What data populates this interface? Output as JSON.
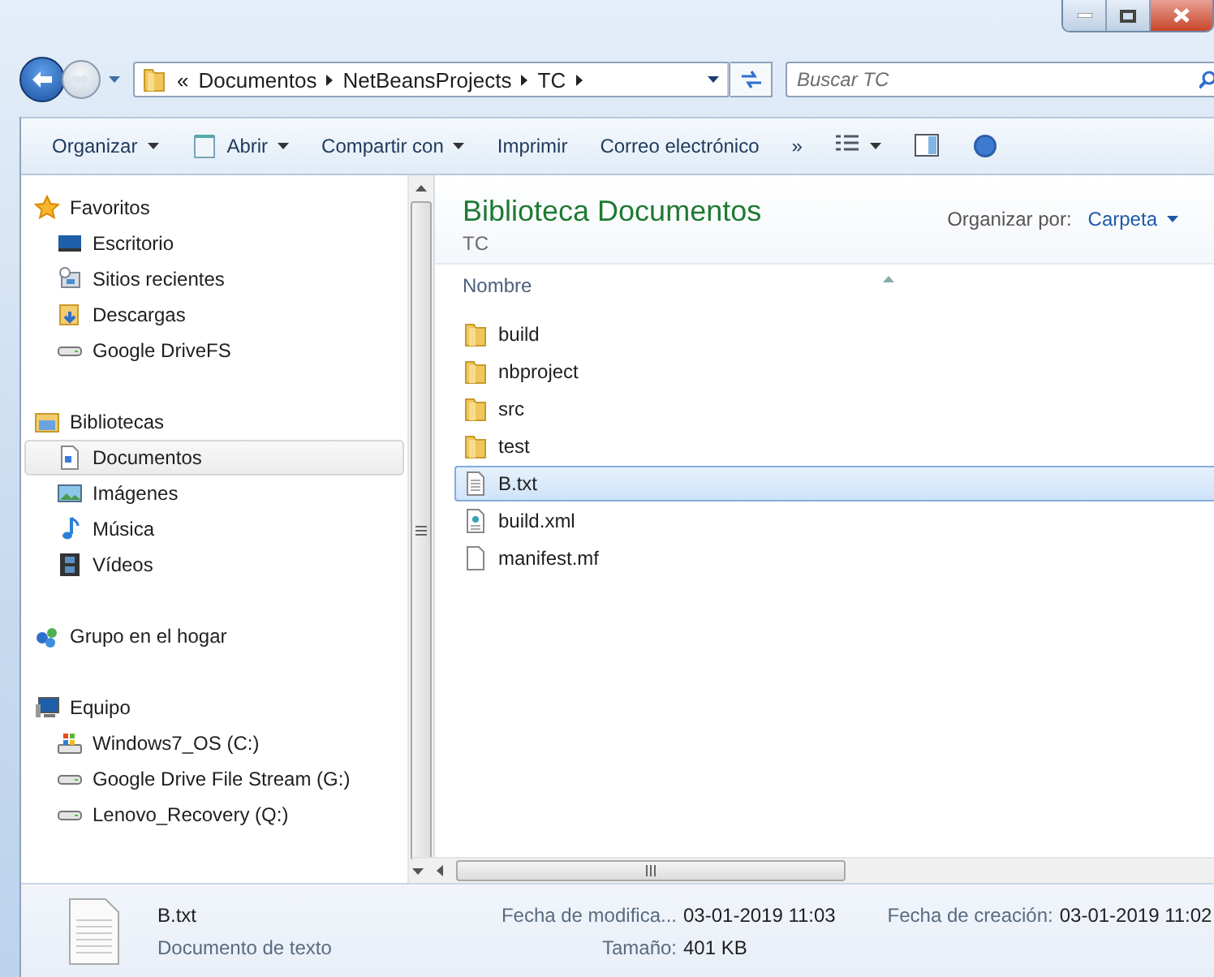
{
  "address_bar": {
    "overflow": "«",
    "crumbs": [
      "Documentos",
      "NetBeansProjects",
      "TC"
    ]
  },
  "search": {
    "placeholder": "Buscar TC"
  },
  "toolbar": [
    {
      "label": "Organizar",
      "dropdown": true,
      "kind": "text"
    },
    {
      "label": "Abrir",
      "dropdown": true,
      "kind": "notepad"
    },
    {
      "label": "Compartir con",
      "dropdown": true,
      "kind": "text"
    },
    {
      "label": "Imprimir",
      "dropdown": false,
      "kind": "text"
    },
    {
      "label": "Correo electrónico",
      "dropdown": false,
      "kind": "text"
    },
    {
      "label": "»",
      "dropdown": false,
      "kind": "text"
    },
    {
      "dropdown": true,
      "kind": "views"
    },
    {
      "dropdown": false,
      "kind": "preview"
    },
    {
      "dropdown": false,
      "kind": "help"
    }
  ],
  "sidebar": {
    "groups": [
      {
        "label": "Favoritos",
        "kind": "star",
        "children": [
          {
            "label": "Escritorio",
            "kind": "desktop",
            "selected": false
          },
          {
            "label": "Sitios recientes",
            "kind": "recent",
            "selected": false
          },
          {
            "label": "Descargas",
            "kind": "downloads",
            "selected": false
          },
          {
            "label": "Google DriveFS",
            "kind": "drive",
            "selected": false
          }
        ]
      },
      {
        "label": "Bibliotecas",
        "kind": "library",
        "children": [
          {
            "label": "Documentos",
            "kind": "document",
            "selected": true
          },
          {
            "label": "Imágenes",
            "kind": "image",
            "selected": false
          },
          {
            "label": "Música",
            "kind": "music",
            "selected": false
          },
          {
            "label": "Vídeos",
            "kind": "video",
            "selected": false
          }
        ]
      },
      {
        "label": "Grupo en el hogar",
        "kind": "homegroup"
      },
      {
        "label": "Equipo",
        "kind": "computer",
        "children": [
          {
            "label": "Windows7_OS (C:)",
            "kind": "windrive",
            "selected": false
          },
          {
            "label": "Google Drive File Stream (G:)",
            "kind": "drive",
            "selected": false
          },
          {
            "label": "Lenovo_Recovery (Q:)",
            "kind": "drive",
            "selected": false
          }
        ]
      }
    ]
  },
  "content": {
    "title": "Biblioteca Documentos",
    "subtitle": "TC",
    "arrange_label": "Organizar por:",
    "arrange_value": "Carpeta",
    "column": "Nombre",
    "files": [
      {
        "name": "build",
        "kind": "folder",
        "selected": false
      },
      {
        "name": "nbproject",
        "kind": "folder",
        "selected": false
      },
      {
        "name": "src",
        "kind": "folder",
        "selected": false
      },
      {
        "name": "test",
        "kind": "folder",
        "selected": false
      },
      {
        "name": "B.txt",
        "kind": "text",
        "selected": true
      },
      {
        "name": "build.xml",
        "kind": "xml",
        "selected": false
      },
      {
        "name": "manifest.mf",
        "kind": "file",
        "selected": false
      }
    ]
  },
  "details": {
    "name": "B.txt",
    "type": "Documento de texto",
    "properties": [
      {
        "label": "Fecha de modifica...",
        "value": "03-01-2019 11:03"
      },
      {
        "label": "Fecha de creación:",
        "value": "03-01-2019 11:02"
      },
      {
        "label": "Tamaño:",
        "value": "401 KB"
      }
    ]
  }
}
